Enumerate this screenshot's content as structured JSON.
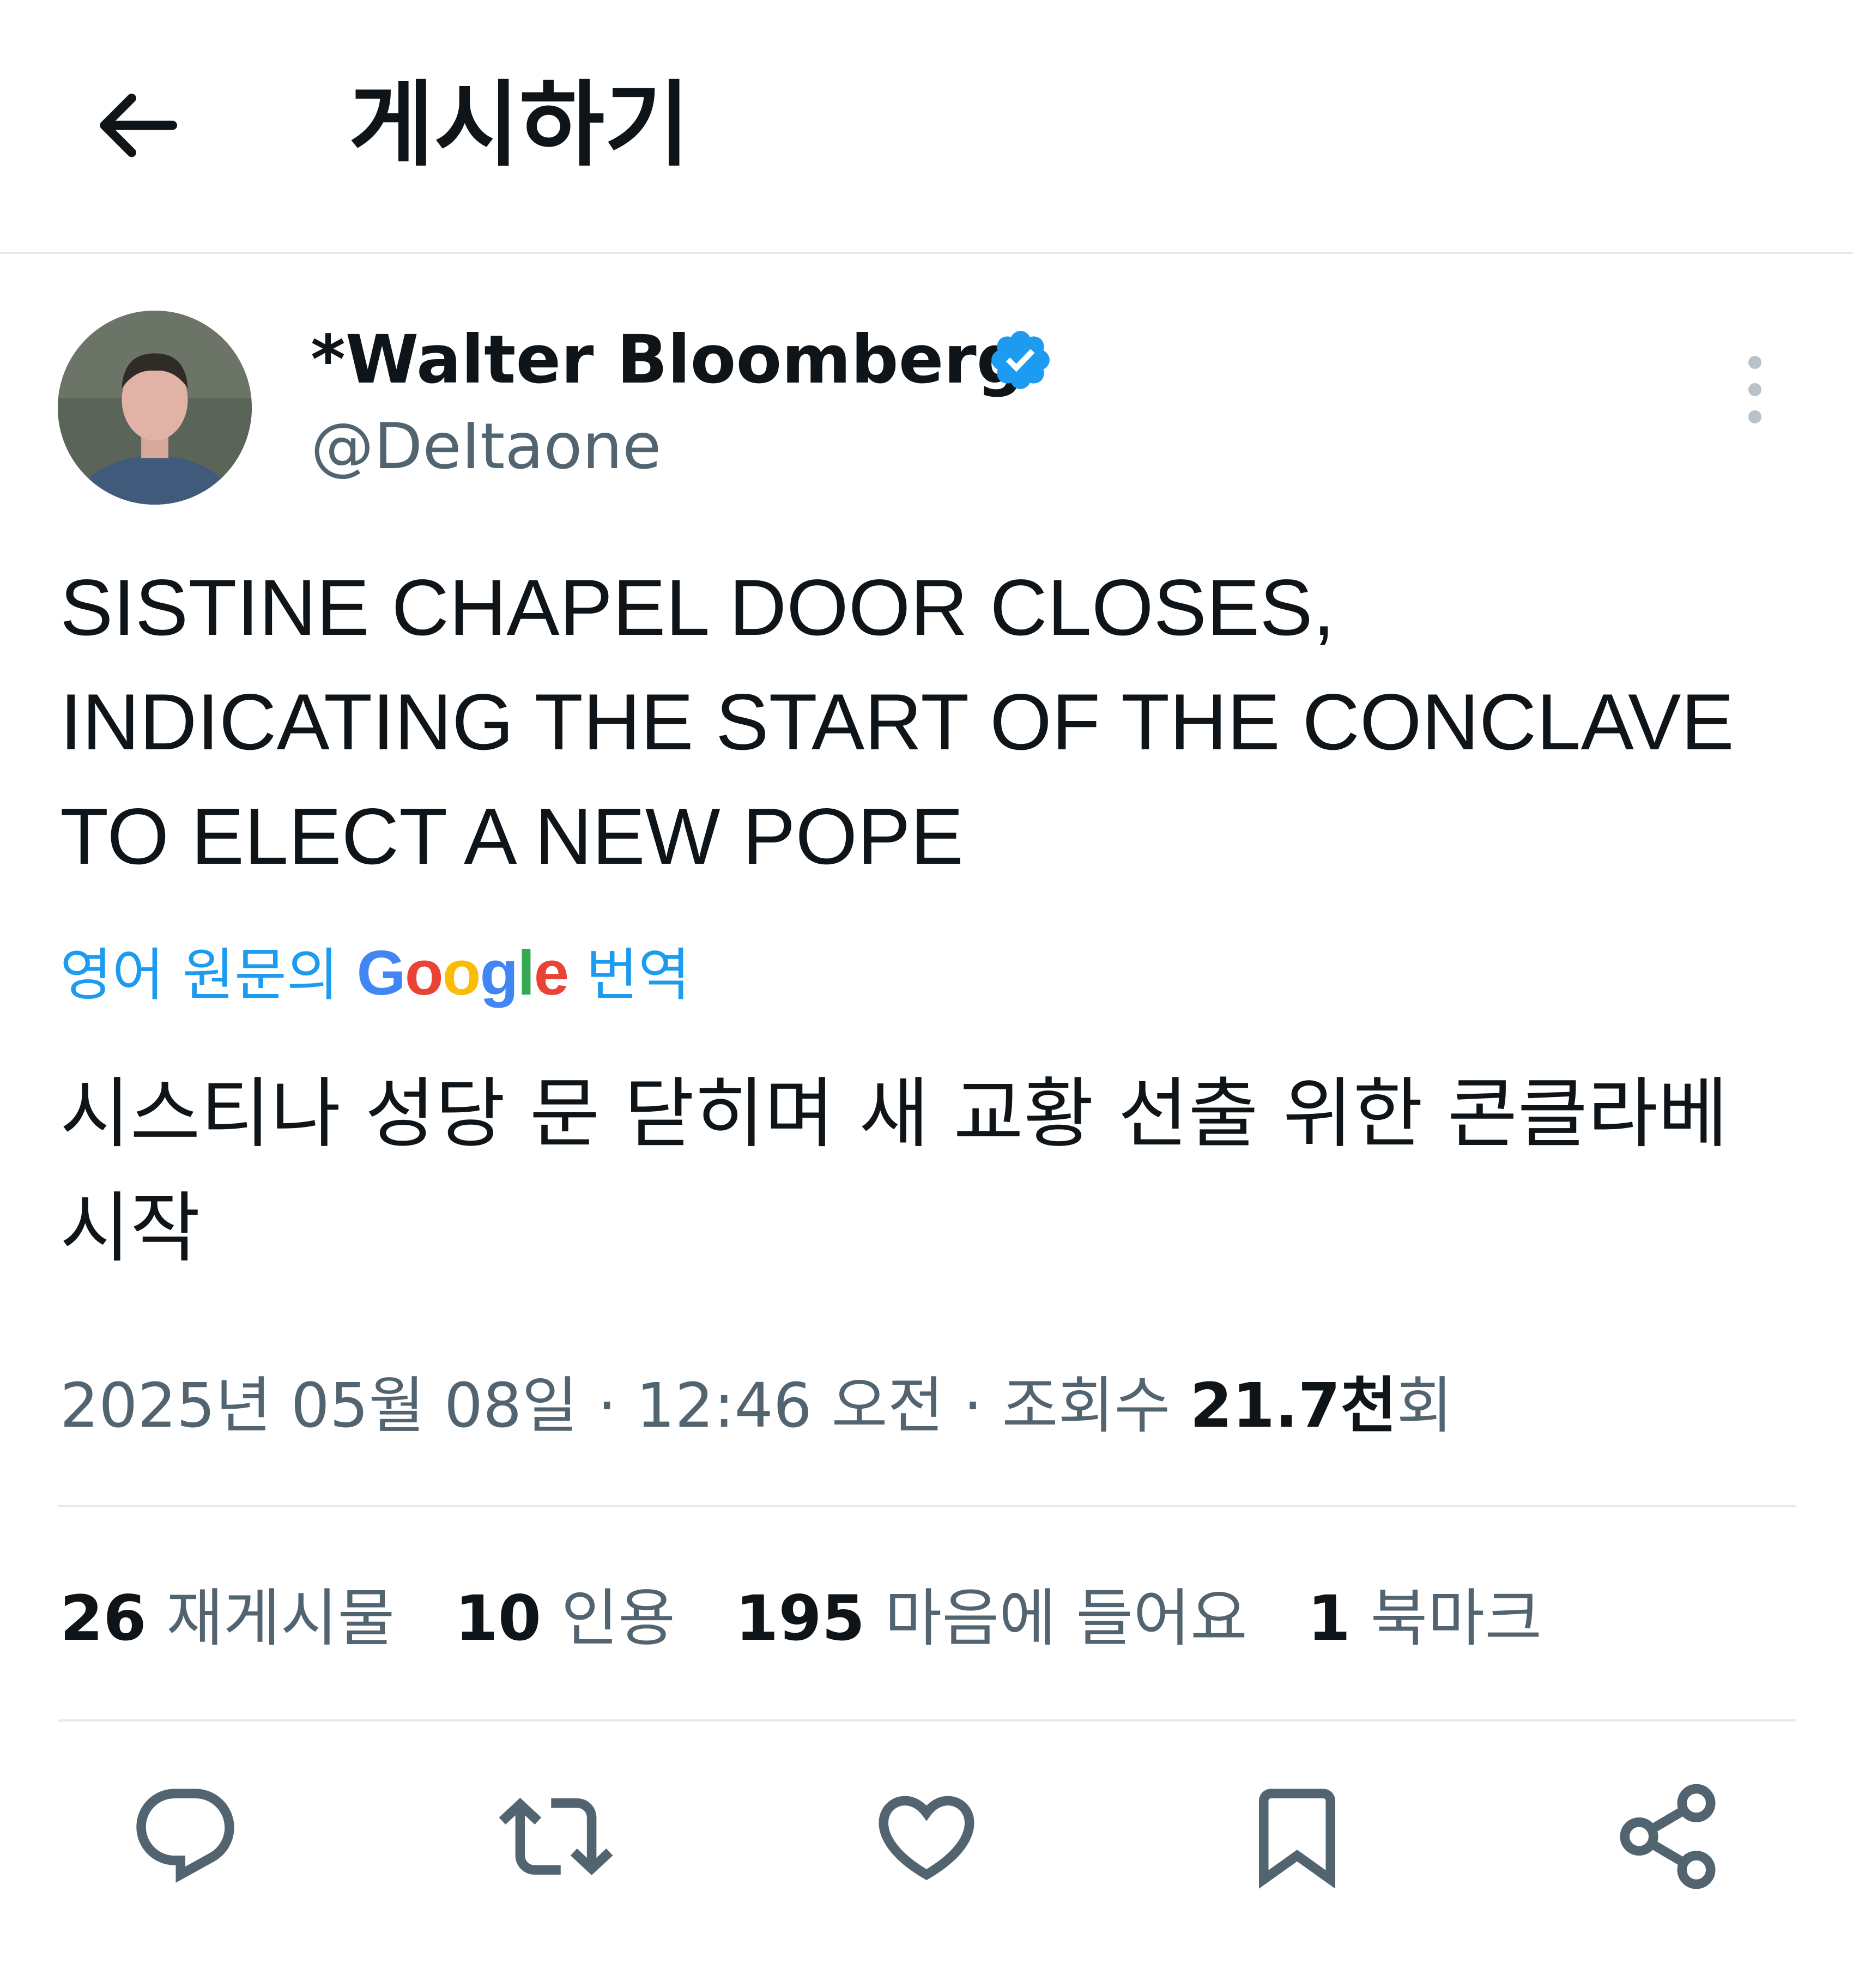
{
  "header": {
    "back_icon": "arrow-left-icon",
    "title": "게시하기"
  },
  "author": {
    "name": "*Walter Bloomberg",
    "handle": "@DeItaone",
    "verified_icon": "verified-badge-icon",
    "verified_color": "#1d9bf0",
    "more_icon": "more-vertical-icon"
  },
  "tweet": {
    "text": "SISTINE CHAPEL DOOR CLOSES, INDICATING THE START OF THE CONCLAVE TO ELECT A NEW POPE",
    "translate_prefix": "영어 원문의",
    "translate_brand": "Google",
    "translate_suffix": "번역",
    "translated_text": "시스티나 성당 문 닫히며 새 교황 선출 위한 콘클라베 시작"
  },
  "meta": {
    "timestamp": "2025년 05월 08일 · 12:46 오전",
    "separator": "·",
    "views_label": "조회수",
    "views_count": "21.7천",
    "views_suffix": "회"
  },
  "stats": {
    "reposts_count": "26",
    "reposts_label": "재게시물",
    "quotes_count": "10",
    "quotes_label": "인용",
    "likes_count": "195",
    "likes_label": "마음에 들어요",
    "bookmarks_count": "1",
    "bookmarks_label": "북마크"
  },
  "actions": [
    {
      "icon": "reply-icon"
    },
    {
      "icon": "repost-icon"
    },
    {
      "icon": "like-icon"
    },
    {
      "icon": "bookmark-icon"
    },
    {
      "icon": "share-icon"
    }
  ],
  "colors": {
    "accent": "#1d9bf0",
    "text_primary": "#0f1419",
    "text_secondary": "#536471",
    "divider": "#e7ebee"
  }
}
